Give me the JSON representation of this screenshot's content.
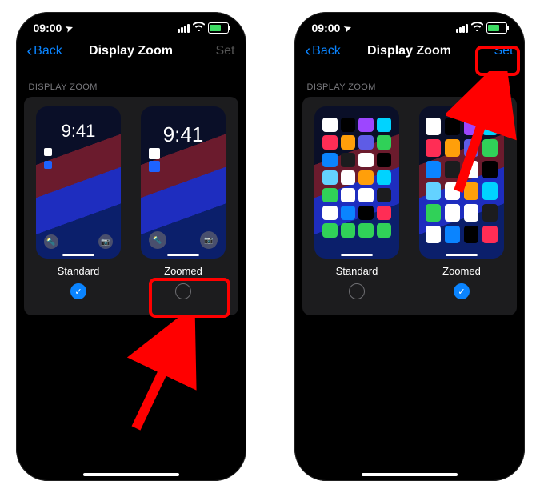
{
  "status": {
    "time": "09:00",
    "loc_icon": "➤"
  },
  "nav": {
    "back": "Back",
    "title": "Display Zoom",
    "set": "Set"
  },
  "section": "DISPLAY ZOOM",
  "options": {
    "standard": "Standard",
    "zoomed": "Zoomed"
  },
  "lock_time": "9:41",
  "screens": {
    "left": {
      "nav_set_state": "disabled",
      "selected": "standard",
      "preview_kind": "lockscreen",
      "annot_target": "zoomed-option"
    },
    "right": {
      "nav_set_state": "enabled",
      "selected": "zoomed",
      "preview_kind": "homescreen",
      "annot_target": "set-button"
    }
  },
  "annotation_color": "#ff0000",
  "app_colors": [
    "#ffffff",
    "#000000",
    "#9d46ff",
    "#00d3ff",
    "#ff2d55",
    "#ff9f0a",
    "#5e5ce6",
    "#30d158",
    "#0a84ff",
    "#1c1c1e",
    "#ffffff",
    "#000000",
    "#64d2ff",
    "#ffffff",
    "#ff9f0a",
    "#00d3ff",
    "#30d158",
    "#ffffff",
    "#ffffff",
    "#1c1c1e",
    "#ffffff",
    "#0a84ff",
    "#000000",
    "#ff2d55",
    "#30d158",
    "#30d158",
    "#30d158",
    "#30d158"
  ]
}
